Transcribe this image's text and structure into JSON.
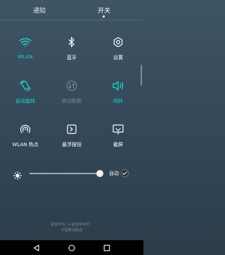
{
  "tabs": {
    "notifications": "通知",
    "switches": "开关"
  },
  "tiles": [
    {
      "label": "WLAN",
      "icon": "wifi-icon",
      "state": "active"
    },
    {
      "label": "蓝牙",
      "icon": "bluetooth-icon",
      "state": "off"
    },
    {
      "label": "设置",
      "icon": "gear-icon",
      "state": "off"
    },
    {
      "label": "自动旋转",
      "icon": "rotate-icon",
      "state": "active"
    },
    {
      "label": "移动数据",
      "icon": "mobile-data-icon",
      "state": "disabled"
    },
    {
      "label": "响铃",
      "icon": "speaker-icon",
      "state": "active"
    },
    {
      "label": "WLAN 热点",
      "icon": "hotspot-icon",
      "state": "off"
    },
    {
      "label": "悬浮按钮",
      "icon": "floating-button-icon",
      "state": "off"
    },
    {
      "label": "截屏",
      "icon": "screenshot-icon",
      "state": "off"
    }
  ],
  "brightness": {
    "auto_label": "自动",
    "level": 0.95,
    "auto_enabled": true
  },
  "footer": {
    "line1": "紧急呼叫（+紧急呼叫号）",
    "line2": "中国移动联通"
  },
  "colors": {
    "accent": "#1fd3c9",
    "background": "#3a4f60"
  }
}
